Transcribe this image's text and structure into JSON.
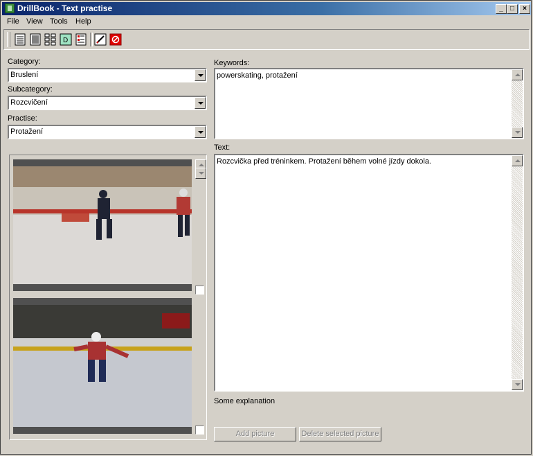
{
  "window": {
    "title": "DrillBook - Text practise"
  },
  "menu": [
    "File",
    "View",
    "Tools",
    "Help"
  ],
  "toolbar": {
    "icons": [
      "list-view-icon",
      "details-view-icon",
      "thumbnails-view-icon",
      "drill-view-icon",
      "report-icon",
      "edit-icon",
      "stop-icon"
    ]
  },
  "form": {
    "category_label": "Category:",
    "category_value": "Bruslení",
    "subcategory_label": "Subcategory:",
    "subcategory_value": "Rozcvičení",
    "practise_label": "Practise:",
    "practise_value": "Protažení",
    "keywords_label": "Keywords:",
    "keywords_value": "powerskating, protažení",
    "text_label": "Text:",
    "text_value": "Rozcvička před tréninkem. Protažení během volné jízdy dokola.",
    "explanation": "Some explanation"
  },
  "buttons": {
    "add_picture": "Add picture",
    "delete_picture": "Delete selected picture"
  },
  "colors": {
    "titlebar_start": "#0a246a",
    "titlebar_end": "#a6caf0",
    "face": "#d4d0c8"
  }
}
